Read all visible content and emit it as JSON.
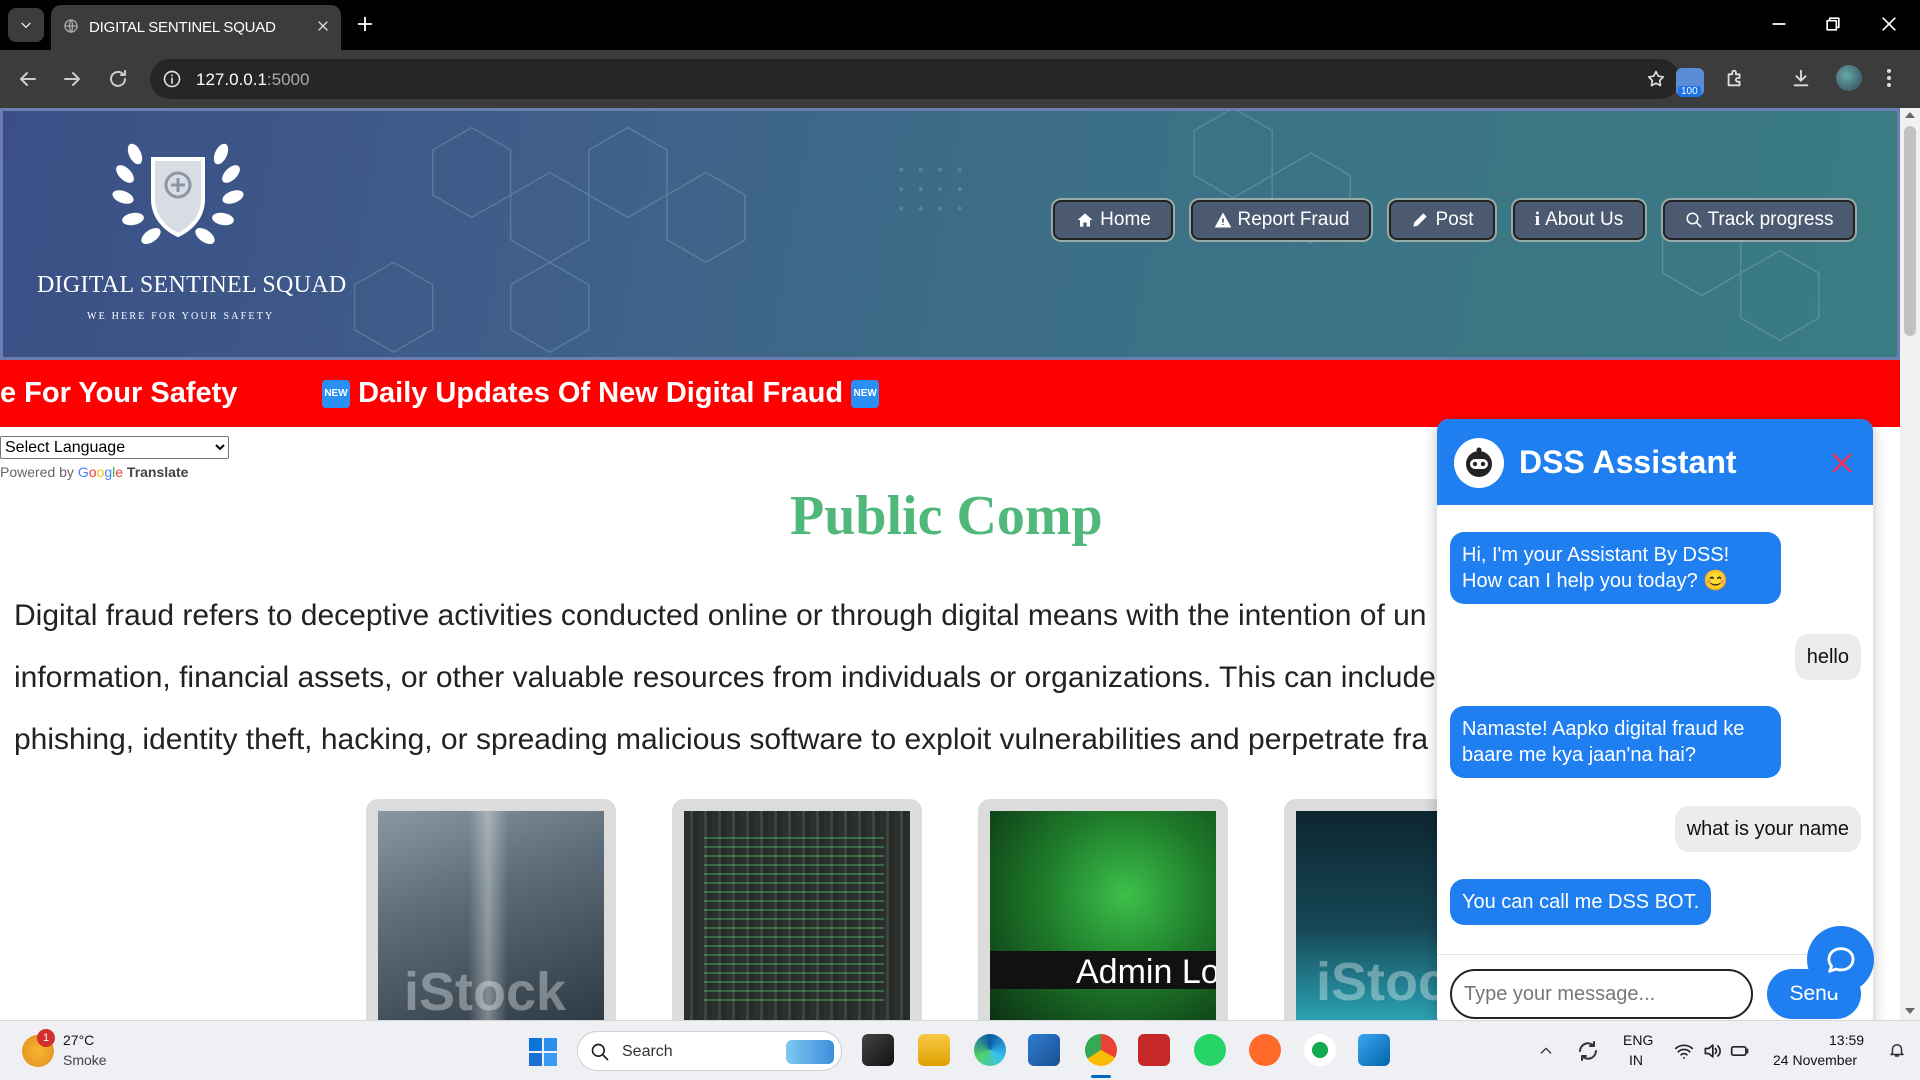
{
  "browser": {
    "tab_title": "DIGITAL SENTINEL SQUAD",
    "url_host": "127.0.0.1",
    "url_port": ":5000",
    "extension_badge": "100"
  },
  "site": {
    "name": "DIGITAL SENTINEL SQUAD",
    "tagline": "WE HERE FOR YOUR SAFETY",
    "nav": {
      "home": "Home",
      "report": "Report Fraud",
      "post": "Post",
      "about": "About Us",
      "track": "Track progress"
    },
    "ticker": {
      "item1": "e For Your Safety",
      "item2": "Daily Updates Of New Digital Fraud",
      "badge": "NEW"
    },
    "language": {
      "selected": "Select Language",
      "powered_by": "Powered by",
      "google": [
        "G",
        "o",
        "o",
        "g",
        "l",
        "e"
      ],
      "translate": "Translate"
    },
    "title": "Public Comp",
    "intro": [
      "Digital fraud refers to deceptive activities conducted online or through digital means with the intention of un",
      "information, financial assets, or other valuable resources from individuals or organizations. This can include",
      "phishing, identity theft, hacking, or spreading malicious software to exploit vulnerabilities and perpetrate fra"
    ],
    "cards": [
      {
        "caption": "iStock"
      },
      {
        "caption": ""
      },
      {
        "caption": "Admin Lo"
      },
      {
        "caption": "iStock"
      }
    ]
  },
  "chat": {
    "title": "DSS Assistant",
    "messages": [
      {
        "from": "bot",
        "line1": "Hi, I'm your Assistant By DSS!",
        "line2": "How can I help you today? 😊"
      },
      {
        "from": "user",
        "line1": "hello"
      },
      {
        "from": "bot",
        "line1": "Namaste! Aapko digital fraud ke",
        "line2": "baare me kya jaan'na hai?"
      },
      {
        "from": "user",
        "line1": "what is your name"
      },
      {
        "from": "bot",
        "line1": "You can call me DSS BOT."
      }
    ],
    "placeholder": "Type your message...",
    "send_label": "Send",
    "colors": {
      "accent": "#1f7ff0",
      "close": "#ff2a4a"
    }
  },
  "taskbar": {
    "weather_temp": "27°C",
    "weather_desc": "Smoke",
    "weather_alert": "1",
    "search_label": "Search",
    "lang_primary": "ENG",
    "lang_secondary": "IN",
    "time": "13:59",
    "date": "24 November"
  }
}
